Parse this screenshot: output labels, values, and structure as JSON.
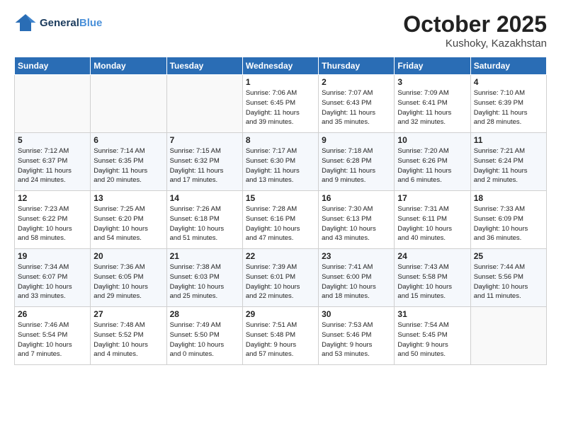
{
  "header": {
    "logo_line1": "General",
    "logo_line2": "Blue",
    "month": "October 2025",
    "location": "Kushoky, Kazakhstan"
  },
  "weekdays": [
    "Sunday",
    "Monday",
    "Tuesday",
    "Wednesday",
    "Thursday",
    "Friday",
    "Saturday"
  ],
  "weeks": [
    [
      {
        "day": "",
        "info": ""
      },
      {
        "day": "",
        "info": ""
      },
      {
        "day": "",
        "info": ""
      },
      {
        "day": "1",
        "info": "Sunrise: 7:06 AM\nSunset: 6:45 PM\nDaylight: 11 hours\nand 39 minutes."
      },
      {
        "day": "2",
        "info": "Sunrise: 7:07 AM\nSunset: 6:43 PM\nDaylight: 11 hours\nand 35 minutes."
      },
      {
        "day": "3",
        "info": "Sunrise: 7:09 AM\nSunset: 6:41 PM\nDaylight: 11 hours\nand 32 minutes."
      },
      {
        "day": "4",
        "info": "Sunrise: 7:10 AM\nSunset: 6:39 PM\nDaylight: 11 hours\nand 28 minutes."
      }
    ],
    [
      {
        "day": "5",
        "info": "Sunrise: 7:12 AM\nSunset: 6:37 PM\nDaylight: 11 hours\nand 24 minutes."
      },
      {
        "day": "6",
        "info": "Sunrise: 7:14 AM\nSunset: 6:35 PM\nDaylight: 11 hours\nand 20 minutes."
      },
      {
        "day": "7",
        "info": "Sunrise: 7:15 AM\nSunset: 6:32 PM\nDaylight: 11 hours\nand 17 minutes."
      },
      {
        "day": "8",
        "info": "Sunrise: 7:17 AM\nSunset: 6:30 PM\nDaylight: 11 hours\nand 13 minutes."
      },
      {
        "day": "9",
        "info": "Sunrise: 7:18 AM\nSunset: 6:28 PM\nDaylight: 11 hours\nand 9 minutes."
      },
      {
        "day": "10",
        "info": "Sunrise: 7:20 AM\nSunset: 6:26 PM\nDaylight: 11 hours\nand 6 minutes."
      },
      {
        "day": "11",
        "info": "Sunrise: 7:21 AM\nSunset: 6:24 PM\nDaylight: 11 hours\nand 2 minutes."
      }
    ],
    [
      {
        "day": "12",
        "info": "Sunrise: 7:23 AM\nSunset: 6:22 PM\nDaylight: 10 hours\nand 58 minutes."
      },
      {
        "day": "13",
        "info": "Sunrise: 7:25 AM\nSunset: 6:20 PM\nDaylight: 10 hours\nand 54 minutes."
      },
      {
        "day": "14",
        "info": "Sunrise: 7:26 AM\nSunset: 6:18 PM\nDaylight: 10 hours\nand 51 minutes."
      },
      {
        "day": "15",
        "info": "Sunrise: 7:28 AM\nSunset: 6:16 PM\nDaylight: 10 hours\nand 47 minutes."
      },
      {
        "day": "16",
        "info": "Sunrise: 7:30 AM\nSunset: 6:13 PM\nDaylight: 10 hours\nand 43 minutes."
      },
      {
        "day": "17",
        "info": "Sunrise: 7:31 AM\nSunset: 6:11 PM\nDaylight: 10 hours\nand 40 minutes."
      },
      {
        "day": "18",
        "info": "Sunrise: 7:33 AM\nSunset: 6:09 PM\nDaylight: 10 hours\nand 36 minutes."
      }
    ],
    [
      {
        "day": "19",
        "info": "Sunrise: 7:34 AM\nSunset: 6:07 PM\nDaylight: 10 hours\nand 33 minutes."
      },
      {
        "day": "20",
        "info": "Sunrise: 7:36 AM\nSunset: 6:05 PM\nDaylight: 10 hours\nand 29 minutes."
      },
      {
        "day": "21",
        "info": "Sunrise: 7:38 AM\nSunset: 6:03 PM\nDaylight: 10 hours\nand 25 minutes."
      },
      {
        "day": "22",
        "info": "Sunrise: 7:39 AM\nSunset: 6:01 PM\nDaylight: 10 hours\nand 22 minutes."
      },
      {
        "day": "23",
        "info": "Sunrise: 7:41 AM\nSunset: 6:00 PM\nDaylight: 10 hours\nand 18 minutes."
      },
      {
        "day": "24",
        "info": "Sunrise: 7:43 AM\nSunset: 5:58 PM\nDaylight: 10 hours\nand 15 minutes."
      },
      {
        "day": "25",
        "info": "Sunrise: 7:44 AM\nSunset: 5:56 PM\nDaylight: 10 hours\nand 11 minutes."
      }
    ],
    [
      {
        "day": "26",
        "info": "Sunrise: 7:46 AM\nSunset: 5:54 PM\nDaylight: 10 hours\nand 7 minutes."
      },
      {
        "day": "27",
        "info": "Sunrise: 7:48 AM\nSunset: 5:52 PM\nDaylight: 10 hours\nand 4 minutes."
      },
      {
        "day": "28",
        "info": "Sunrise: 7:49 AM\nSunset: 5:50 PM\nDaylight: 10 hours\nand 0 minutes."
      },
      {
        "day": "29",
        "info": "Sunrise: 7:51 AM\nSunset: 5:48 PM\nDaylight: 9 hours\nand 57 minutes."
      },
      {
        "day": "30",
        "info": "Sunrise: 7:53 AM\nSunset: 5:46 PM\nDaylight: 9 hours\nand 53 minutes."
      },
      {
        "day": "31",
        "info": "Sunrise: 7:54 AM\nSunset: 5:45 PM\nDaylight: 9 hours\nand 50 minutes."
      },
      {
        "day": "",
        "info": ""
      }
    ]
  ]
}
